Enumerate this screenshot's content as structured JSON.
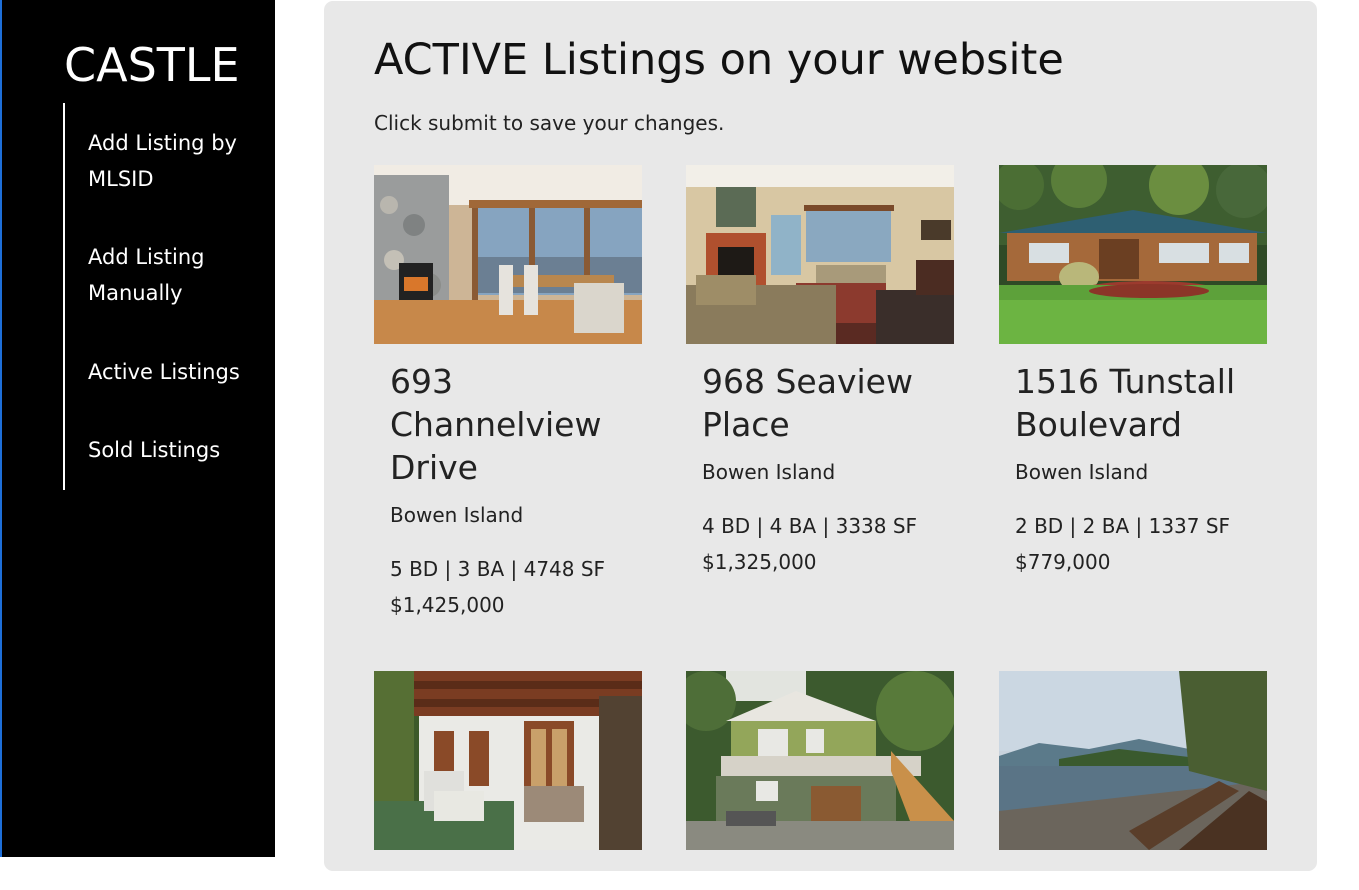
{
  "sidebar": {
    "brand": "CASTLE",
    "items": [
      {
        "label": "Add Listing by MLSID"
      },
      {
        "label": "Add Listing Manually"
      },
      {
        "label": "Active Listings"
      },
      {
        "label": "Sold Listings"
      }
    ]
  },
  "main": {
    "title": "ACTIVE Listings on your website",
    "subtitle": "Click submit to save your changes.",
    "listings": [
      {
        "address": "693 Channelview Drive",
        "city": "Bowen Island",
        "specs": "5 BD | 3 BA | 4748 SF",
        "price": "$1,425,000"
      },
      {
        "address": "968 Seaview Place",
        "city": "Bowen Island",
        "specs": "4 BD | 4 BA | 3338 SF",
        "price": "$1,325,000"
      },
      {
        "address": "1516 Tunstall Boulevard",
        "city": "Bowen Island",
        "specs": "2 BD | 2 BA | 1337 SF",
        "price": "$779,000"
      },
      {
        "address": "",
        "city": "",
        "specs": "",
        "price": ""
      },
      {
        "address": "",
        "city": "",
        "specs": "",
        "price": ""
      },
      {
        "address": "",
        "city": "",
        "specs": "",
        "price": ""
      }
    ]
  },
  "colors": {
    "sidebar_bg": "#000000",
    "panel_bg": "#e8e8e8",
    "accent_edge": "#1e6fd9"
  }
}
